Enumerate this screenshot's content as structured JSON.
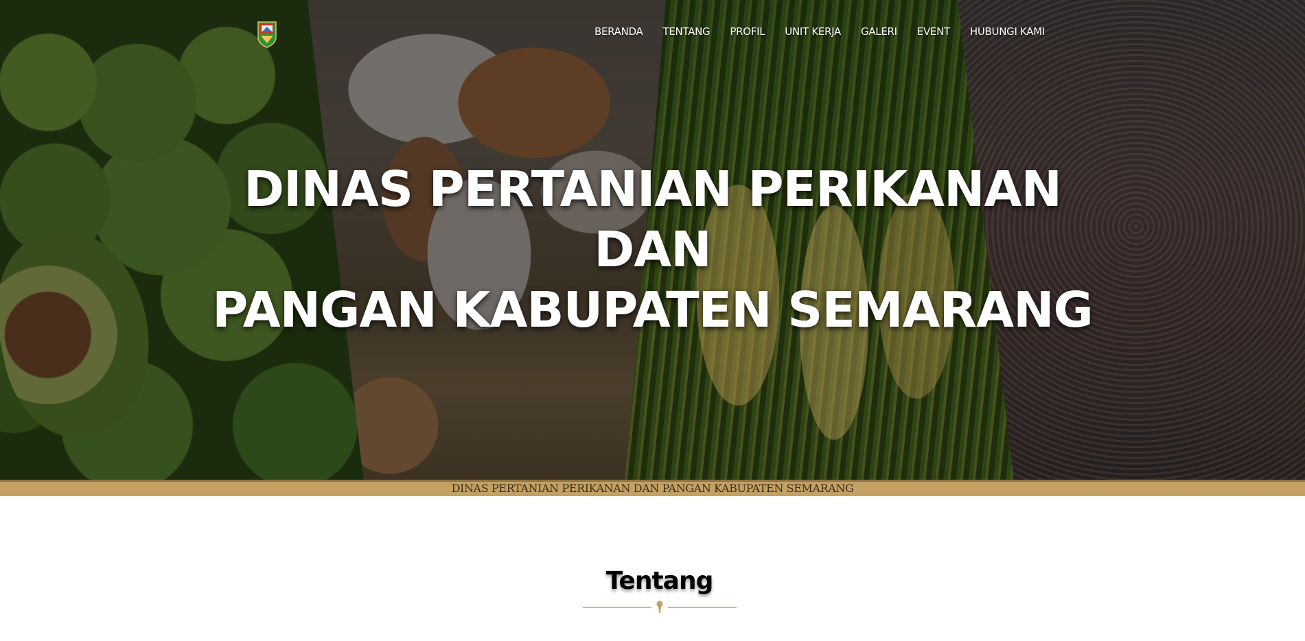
{
  "header": {
    "nav": [
      {
        "label": "BERANDA"
      },
      {
        "label": "TENTANG"
      },
      {
        "label": "PROFIL"
      },
      {
        "label": "UNIT KERJA"
      },
      {
        "label": "GALERI"
      },
      {
        "label": "EVENT"
      },
      {
        "label": "HUBUNGI KAMI"
      }
    ],
    "logo_icon": "regency-crest-icon"
  },
  "hero": {
    "title_line1": "DINAS PERTANIAN PERIKANAN DAN",
    "title_line2": "PANGAN KABUPATEN SEMARANG"
  },
  "ticker": {
    "text": "DINAS PERTANIAN PERIKANAN DAN PANGAN KABUPATEN SEMARANG"
  },
  "about": {
    "heading": "Tentang"
  },
  "colors": {
    "accent_gold": "#c4a062",
    "nav_text": "#ffffff"
  }
}
